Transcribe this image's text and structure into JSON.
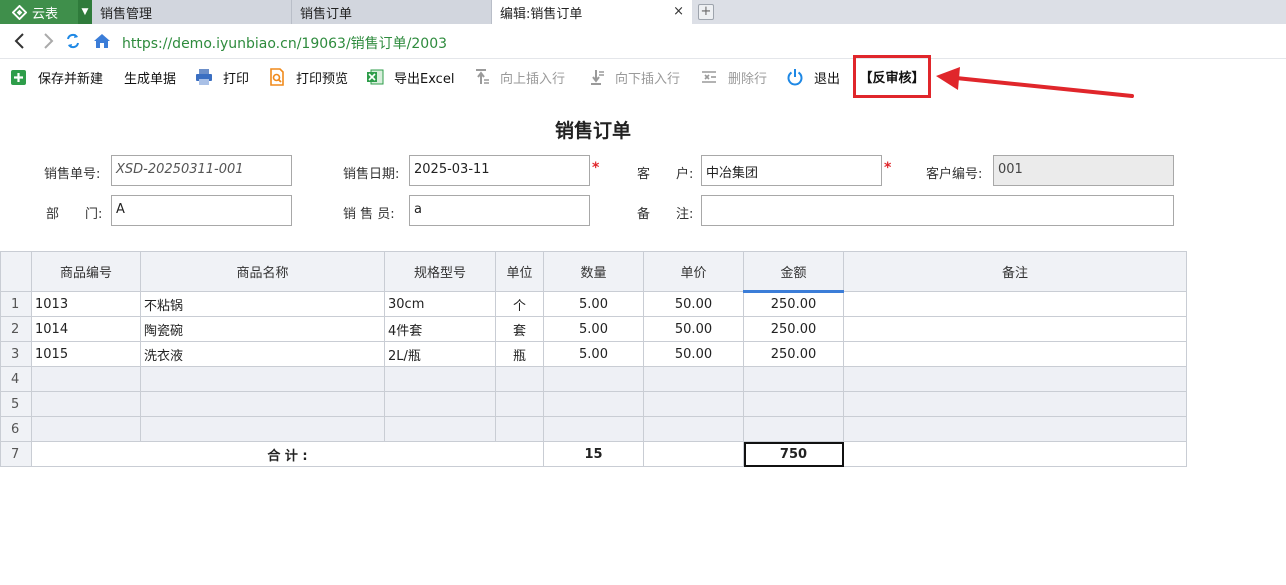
{
  "tabs": {
    "app_name": "云表",
    "items": [
      {
        "label": "销售管理"
      },
      {
        "label": "销售订单"
      },
      {
        "label": "编辑:销售订单"
      }
    ],
    "close_glyph": "×",
    "new_tab_glyph": "+"
  },
  "address": {
    "url": "https://demo.iyunbiao.cn/19063/销售订单/2003"
  },
  "toolbar": {
    "save_new": "保存并新建",
    "generate": "生成单据",
    "print": "打印",
    "print_preview": "打印预览",
    "export_excel": "导出Excel",
    "insert_above": "向上插入行",
    "insert_below": "向下插入行",
    "delete_row": "删除行",
    "exit": "退出",
    "unreview": "【反审核】"
  },
  "form": {
    "title": "销售订单",
    "order_no_label": "销售单号:",
    "order_no": "XSD-20250311-001",
    "date_label": "销售日期:",
    "date": "2025-03-11",
    "customer_label": "客　　户:",
    "customer": "中冶集团",
    "customer_code_label": "客户编号:",
    "customer_code": "001",
    "dept_label": "部　　门:",
    "dept": "A",
    "salesperson_label": "销 售 员:",
    "salesperson": "a",
    "remark_label": "备　　注:",
    "remark": "",
    "required_mark": "*"
  },
  "grid": {
    "headers": [
      "商品编号",
      "商品名称",
      "规格型号",
      "单位",
      "数量",
      "单价",
      "金额",
      "备注"
    ],
    "rows": [
      {
        "no": "1",
        "code": "1013",
        "name": "不粘锅",
        "spec": "30cm",
        "unit": "个",
        "qty": "5.00",
        "price": "50.00",
        "amount": "250.00",
        "remark": ""
      },
      {
        "no": "2",
        "code": "1014",
        "name": "陶瓷碗",
        "spec": "4件套",
        "unit": "套",
        "qty": "5.00",
        "price": "50.00",
        "amount": "250.00",
        "remark": ""
      },
      {
        "no": "3",
        "code": "1015",
        "name": "洗衣液",
        "spec": "2L/瓶",
        "unit": "瓶",
        "qty": "5.00",
        "price": "50.00",
        "amount": "250.00",
        "remark": ""
      }
    ],
    "empty_rows": [
      "4",
      "5",
      "6"
    ],
    "total": {
      "no": "7",
      "label": "合 计 :",
      "qty": "15",
      "amount": "750"
    }
  }
}
